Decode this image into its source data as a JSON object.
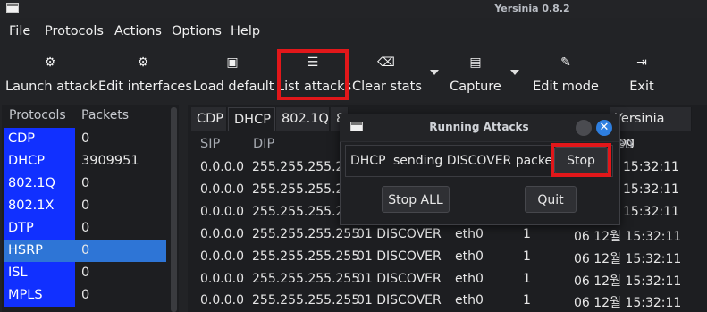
{
  "window": {
    "title": "Yersinia 0.8.2"
  },
  "menu": [
    "File",
    "Protocols",
    "Actions",
    "Options",
    "Help"
  ],
  "toolbar": [
    {
      "label": "Launch attack",
      "icon": "gears-icon"
    },
    {
      "label": "Edit interfaces",
      "icon": "gears-icon"
    },
    {
      "label": "Load default",
      "icon": "monitor-icon"
    },
    {
      "label": "List attacks",
      "icon": "list-icon"
    },
    {
      "label": "Clear stats",
      "icon": "backspace-icon"
    },
    {
      "label": "Capture",
      "icon": "floppy-icon"
    },
    {
      "label": "Edit mode",
      "icon": "pencil-icon"
    },
    {
      "label": "Exit",
      "icon": "exit-icon"
    }
  ],
  "protocols_panel": {
    "headers": [
      "Protocols",
      "Packets"
    ],
    "rows": [
      {
        "protocol": "CDP",
        "packets": "0"
      },
      {
        "protocol": "DHCP",
        "packets": "3909951"
      },
      {
        "protocol": "802.1Q",
        "packets": "0"
      },
      {
        "protocol": "802.1X",
        "packets": "0"
      },
      {
        "protocol": "DTP",
        "packets": "0"
      },
      {
        "protocol": "HSRP",
        "packets": "0"
      },
      {
        "protocol": "ISL",
        "packets": "0"
      },
      {
        "protocol": "MPLS",
        "packets": "0"
      }
    ],
    "selected": "HSRP"
  },
  "tabs": [
    "CDP",
    "DHCP",
    "802.1Q",
    "8"
  ],
  "tab_log": "Yersinia log",
  "active_tab": "DHCP",
  "table": {
    "headers": [
      "SIP",
      "DIP",
      "",
      "",
      "",
      "en"
    ],
    "rows": [
      {
        "sip": "0.0.0.0",
        "dip": "255.255.255.255",
        "msg": "",
        "iface": "",
        "count": "",
        "time": "15:32:11"
      },
      {
        "sip": "0.0.0.0",
        "dip": "255.255.255.255",
        "msg": "",
        "iface": "",
        "count": "",
        "time": "15:32:11"
      },
      {
        "sip": "0.0.0.0",
        "dip": "255.255.255.255",
        "msg": "",
        "iface": "",
        "count": "",
        "time": "15:32:11"
      },
      {
        "sip": "0.0.0.0",
        "dip": "255.255.255.255",
        "msg": "01 DISCOVER",
        "iface": "eth0",
        "count": "1",
        "time": "06 12월 15:32:11"
      },
      {
        "sip": "0.0.0.0",
        "dip": "255.255.255.255",
        "msg": "01 DISCOVER",
        "iface": "eth0",
        "count": "1",
        "time": "06 12월 15:32:11"
      },
      {
        "sip": "0.0.0.0",
        "dip": "255.255.255.255",
        "msg": "01 DISCOVER",
        "iface": "eth0",
        "count": "1",
        "time": "06 12월 15:32:11"
      },
      {
        "sip": "0.0.0.0",
        "dip": "255.255.255.255",
        "msg": "01 DISCOVER",
        "iface": "eth0",
        "count": "1",
        "time": "06 12월 15:32:11"
      }
    ]
  },
  "dialog": {
    "title": "Running Attacks",
    "protocol": "DHCP",
    "attack": "sending DISCOVER packet",
    "stop_label": "Stop",
    "stop_all_label": "Stop ALL",
    "quit_label": "Quit"
  },
  "colors": {
    "highlight": "#e2171a",
    "protocol_bg": "#1130ff",
    "selected_row": "#2e75d6"
  }
}
